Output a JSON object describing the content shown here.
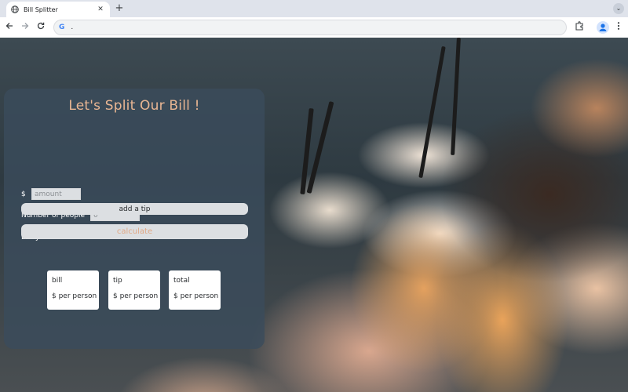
{
  "browser": {
    "tab_title": "Bill Splitter",
    "tab_close": "✕",
    "new_tab": "+",
    "tab_search": "⌄",
    "address": ".",
    "google_glyph": "G",
    "icons": {
      "back": "back-arrow-icon",
      "forward": "forward-arrow-icon",
      "reload": "reload-icon",
      "extensions": "puzzle-icon",
      "profile": "profile-icon",
      "menu": "kebab-menu-icon"
    }
  },
  "app": {
    "title": "Let's Split Our Bill !",
    "amount": {
      "prefix": "$",
      "placeholder": "amount",
      "value": ""
    },
    "people": {
      "label": "Number of people",
      "placeholder": "0",
      "value": ""
    },
    "service_question": "Did you like our service?",
    "add_tip_label": "add a tip",
    "calculate_label": "calculate",
    "results": [
      {
        "label": "bill",
        "value": "$ per person"
      },
      {
        "label": "tip",
        "value": "$ per person"
      },
      {
        "label": "total",
        "value": "$ per person"
      }
    ]
  },
  "colors": {
    "title": "#e9b693",
    "calculate_text": "#e0a987",
    "card": "#3a4c5c"
  }
}
